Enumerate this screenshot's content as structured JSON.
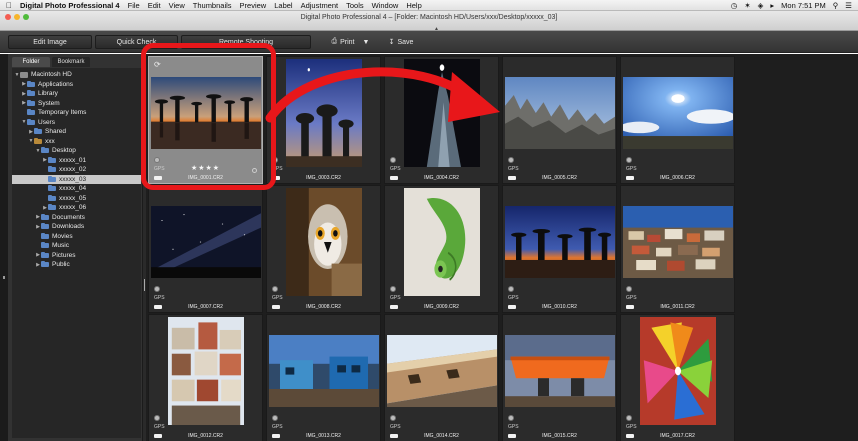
{
  "menubar": {
    "app_name": "Digital Photo Professional 4",
    "items": [
      "File",
      "Edit",
      "View",
      "Thumbnails",
      "Preview",
      "Label",
      "Adjustment",
      "Tools",
      "Window",
      "Help"
    ],
    "clock": "Mon 7:51 PM"
  },
  "window": {
    "title": "Digital Photo Professional 4 – [Folder: Macintosh HD/Users/xxx/Desktop/xxxxx_03]"
  },
  "toolbar": {
    "edit_image": "Edit Image",
    "quick_check": "Quick Check",
    "remote_shooting": "Remote Shooting",
    "print": "Print",
    "save": "Save"
  },
  "panel": {
    "tabs": [
      "Folder",
      "Bookmark"
    ]
  },
  "tree": [
    {
      "label": "Macintosh HD",
      "depth": 0,
      "arrow": "▼",
      "kind": "disk"
    },
    {
      "label": "Applications",
      "depth": 1,
      "arrow": "▶",
      "kind": "folder"
    },
    {
      "label": "Library",
      "depth": 1,
      "arrow": "▶",
      "kind": "folder"
    },
    {
      "label": "System",
      "depth": 1,
      "arrow": "▶",
      "kind": "folder"
    },
    {
      "label": "Temporary Items",
      "depth": 1,
      "arrow": "",
      "kind": "folder"
    },
    {
      "label": "Users",
      "depth": 1,
      "arrow": "▼",
      "kind": "folder"
    },
    {
      "label": "Shared",
      "depth": 2,
      "arrow": "▶",
      "kind": "folder"
    },
    {
      "label": "xxx",
      "depth": 2,
      "arrow": "▼",
      "kind": "home"
    },
    {
      "label": "Desktop",
      "depth": 3,
      "arrow": "▼",
      "kind": "folder"
    },
    {
      "label": "xxxxx_01",
      "depth": 4,
      "arrow": "▶",
      "kind": "folder"
    },
    {
      "label": "xxxxx_02",
      "depth": 4,
      "arrow": "",
      "kind": "folder"
    },
    {
      "label": "xxxxx_03",
      "depth": 4,
      "arrow": "",
      "kind": "folder",
      "selected": true
    },
    {
      "label": "xxxxx_04",
      "depth": 4,
      "arrow": "",
      "kind": "folder"
    },
    {
      "label": "xxxxx_05",
      "depth": 4,
      "arrow": "",
      "kind": "folder"
    },
    {
      "label": "xxxxx_06",
      "depth": 4,
      "arrow": "▶",
      "kind": "folder"
    },
    {
      "label": "Documents",
      "depth": 3,
      "arrow": "▶",
      "kind": "folder"
    },
    {
      "label": "Downloads",
      "depth": 3,
      "arrow": "▶",
      "kind": "folder"
    },
    {
      "label": "Movies",
      "depth": 3,
      "arrow": "",
      "kind": "folder"
    },
    {
      "label": "Music",
      "depth": 3,
      "arrow": "",
      "kind": "folder"
    },
    {
      "label": "Pictures",
      "depth": 3,
      "arrow": "▶",
      "kind": "folder"
    },
    {
      "label": "Public",
      "depth": 3,
      "arrow": "▶",
      "kind": "folder"
    }
  ],
  "thumbnails": [
    {
      "file": "IMG_0001.CR2",
      "scene": "baobab-sunset",
      "orient": "land",
      "selected": true,
      "stars": "★★★★",
      "gps": "GPS"
    },
    {
      "file": "IMG_0003.CR2",
      "scene": "baobab-night",
      "orient": "port",
      "gps": "GPS"
    },
    {
      "file": "IMG_0004.CR2",
      "scene": "rock-night",
      "orient": "port",
      "gps": "GPS"
    },
    {
      "file": "IMG_0005.CR2",
      "scene": "tsingy",
      "orient": "land",
      "gps": "GPS"
    },
    {
      "file": "IMG_0006.CR2",
      "scene": "sky-sun",
      "orient": "land",
      "gps": "GPS"
    },
    {
      "file": "IMG_0007.CR2",
      "scene": "milkyway",
      "orient": "land",
      "gps": "GPS"
    },
    {
      "file": "IMG_0008.CR2",
      "scene": "lemur",
      "orient": "port",
      "gps": "GPS"
    },
    {
      "file": "IMG_0009.CR2",
      "scene": "chameleon",
      "orient": "port",
      "gps": "GPS"
    },
    {
      "file": "IMG_0010.CR2",
      "scene": "baobab-dusk",
      "orient": "land",
      "gps": "GPS"
    },
    {
      "file": "IMG_0011.CR2",
      "scene": "town-hill",
      "orient": "land",
      "gps": "GPS"
    },
    {
      "file": "IMG_0012.CR2",
      "scene": "town-vertical",
      "orient": "port",
      "gps": "GPS"
    },
    {
      "file": "IMG_0013.CR2",
      "scene": "street-blue",
      "orient": "land",
      "gps": "GPS"
    },
    {
      "file": "IMG_0014.CR2",
      "scene": "tilted-building",
      "orient": "land",
      "gps": "GPS"
    },
    {
      "file": "IMG_0015.CR2",
      "scene": "orange-awning",
      "orient": "land",
      "gps": "GPS"
    },
    {
      "file": "IMG_0017.CR2",
      "scene": "pinwheel",
      "orient": "port",
      "gps": "GPS"
    }
  ],
  "colors": {
    "highlight_box": "#e8171a",
    "folder_icon": "#5a86c5",
    "selected_cell": "#8b8b8b"
  }
}
